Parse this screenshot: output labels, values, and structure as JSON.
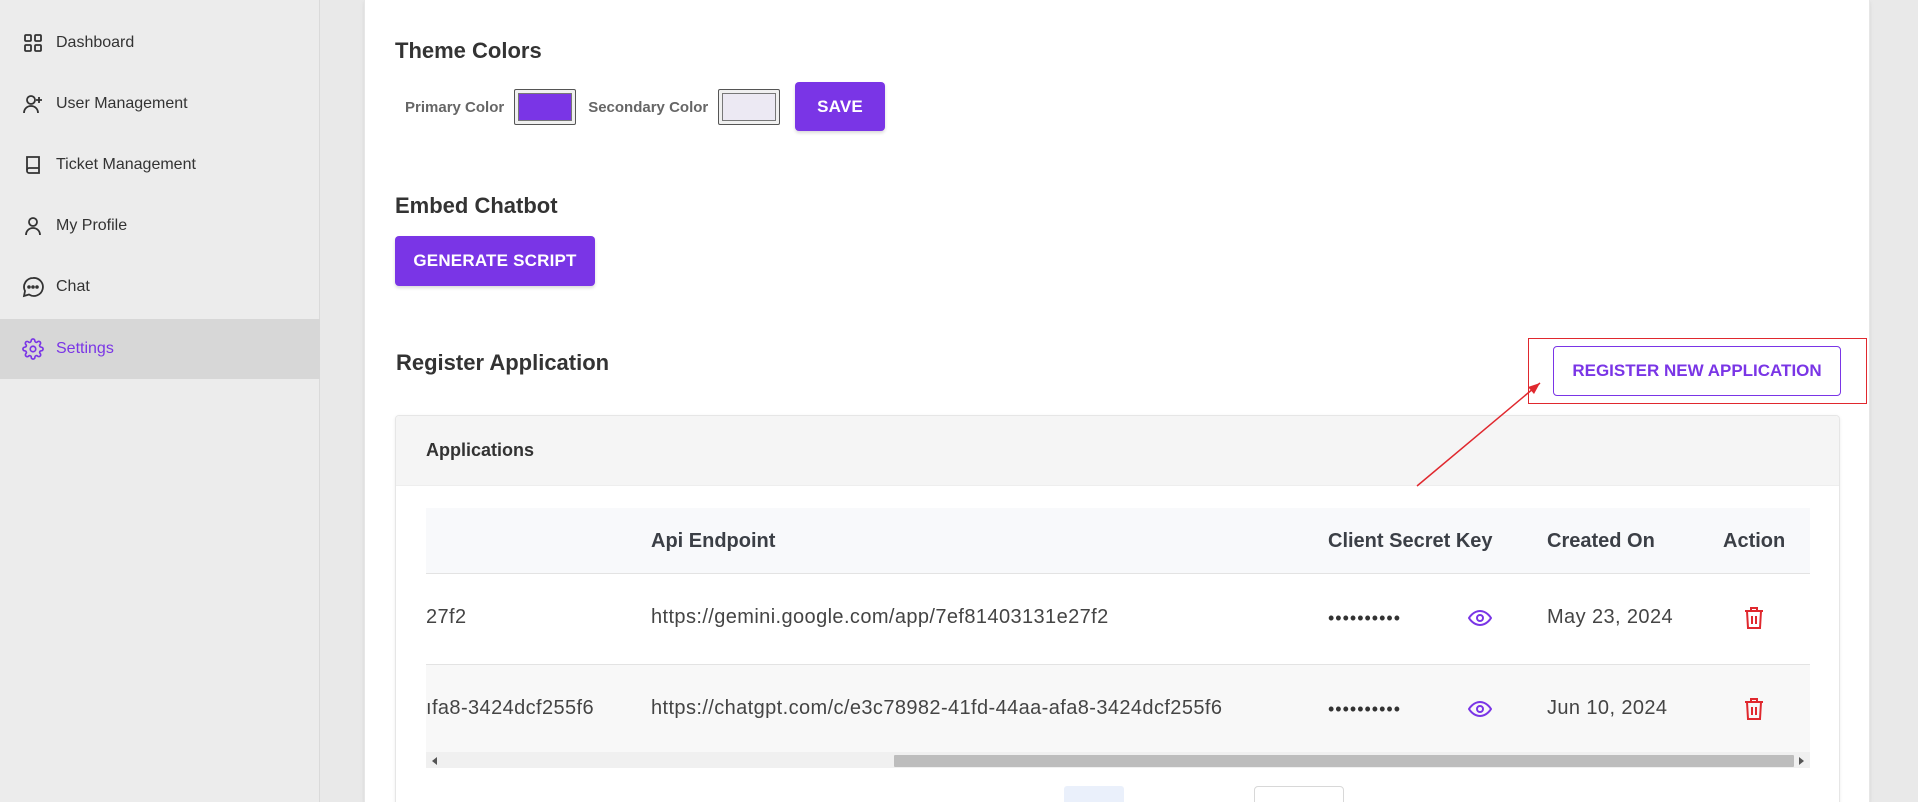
{
  "sidebar": {
    "items": [
      {
        "label": "Dashboard",
        "icon": "grid-icon"
      },
      {
        "label": "User Management",
        "icon": "user-plus-icon"
      },
      {
        "label": "Ticket Management",
        "icon": "book-icon"
      },
      {
        "label": "My Profile",
        "icon": "user-icon"
      },
      {
        "label": "Chat",
        "icon": "chat-bubble-icon"
      },
      {
        "label": "Settings",
        "icon": "gear-icon",
        "active": true
      }
    ]
  },
  "theme": {
    "title": "Theme Colors",
    "primary_label": "Primary Color",
    "primary_value": "#7a35e6",
    "secondary_label": "Secondary Color",
    "secondary_value": "#ece9f3",
    "save_label": "SAVE"
  },
  "embed": {
    "title": "Embed Chatbot",
    "generate_label": "GENERATE SCRIPT"
  },
  "register": {
    "title": "Register Application",
    "new_app_label": "REGISTER NEW APPLICATION"
  },
  "applications": {
    "title": "Applications",
    "columns": [
      "Api Endpoint",
      "Client Secret Key",
      "Created On",
      "Action"
    ],
    "rows": [
      {
        "id_fragment": "27f2",
        "api_endpoint": "https://gemini.google.com/app/7ef81403131e27f2",
        "secret": "••••••••••",
        "created_on": "May 23, 2024"
      },
      {
        "id_fragment": "ıfa8-3424dcf255f6",
        "api_endpoint": "https://chatgpt.com/c/e3c78982-41fd-44aa-afa8-3424dcf255f6",
        "secret": "••••••••••",
        "created_on": "Jun 10, 2024"
      }
    ]
  },
  "colors": {
    "accent": "#7a35e6",
    "danger": "#e0282e"
  }
}
